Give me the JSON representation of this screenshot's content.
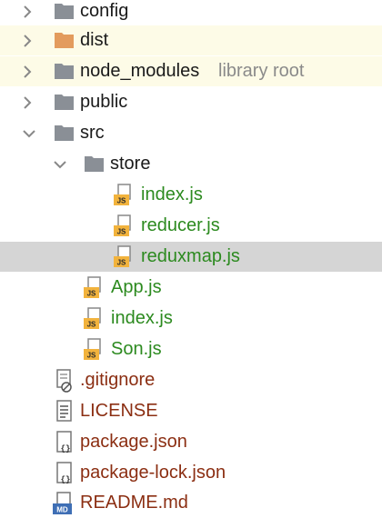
{
  "tree": {
    "config": {
      "label": "config",
      "icon": "folder-icon",
      "color": "#8a8f96"
    },
    "dist": {
      "label": "dist",
      "icon": "excluded-folder-icon",
      "color": "#e39b5d"
    },
    "node_modules": {
      "label": "node_modules",
      "hint": "library root",
      "icon": "folder-icon"
    },
    "public": {
      "label": "public",
      "icon": "folder-icon"
    },
    "src": {
      "label": "src",
      "icon": "folder-icon",
      "expanded": true
    },
    "store": {
      "label": "store",
      "icon": "folder-icon",
      "expanded": true
    },
    "store_index": {
      "label": "index.js",
      "icon": "js-file-icon"
    },
    "store_reducer": {
      "label": "reducer.js",
      "icon": "js-file-icon"
    },
    "store_reduxmap": {
      "label": "reduxmap.js",
      "icon": "js-file-icon",
      "selected": true
    },
    "app": {
      "label": "App.js",
      "icon": "js-file-icon"
    },
    "src_index": {
      "label": "index.js",
      "icon": "js-file-icon"
    },
    "son": {
      "label": "Son.js",
      "icon": "js-file-icon"
    },
    "gitignore": {
      "label": ".gitignore",
      "icon": "ignore-file-icon"
    },
    "license": {
      "label": "LICENSE",
      "icon": "text-file-icon"
    },
    "package_json": {
      "label": "package.json",
      "icon": "json-file-icon"
    },
    "package_lock": {
      "label": "package-lock.json",
      "icon": "json-file-icon"
    },
    "readme": {
      "label": "README.md",
      "icon": "markdown-file-icon"
    }
  },
  "badges": {
    "js": "JS",
    "md": "MD",
    "json": "{}"
  },
  "colors": {
    "yellow_highlight": "#fdfbe7",
    "selected": "#d5d5d5",
    "green_text": "#2c8a1f",
    "brown_text": "#8b2e12",
    "folder_gray": "#8a8f96",
    "excluded_orange": "#e39b5d"
  }
}
